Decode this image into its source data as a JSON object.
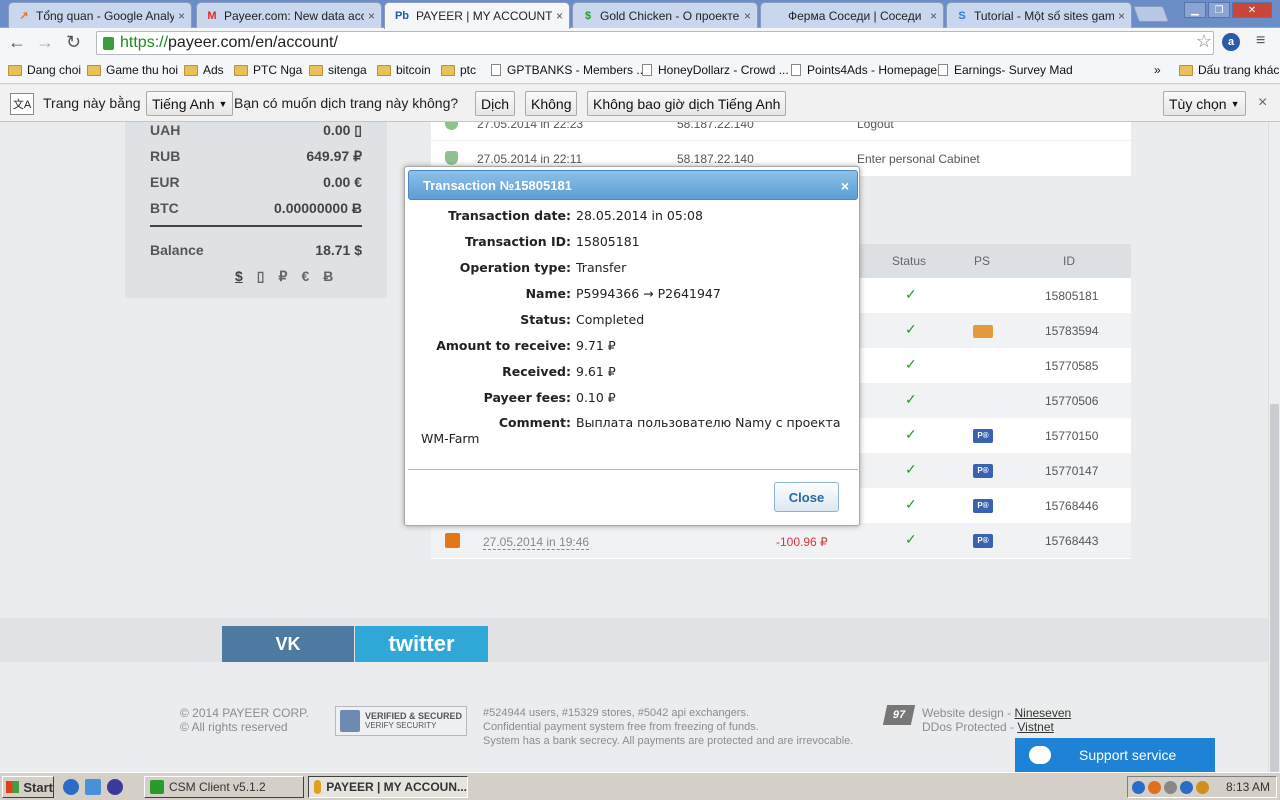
{
  "browser": {
    "tabs": [
      {
        "label": "Tổng quan - Google Analytic",
        "favicon": "analytics-icon",
        "color": "#e4761c"
      },
      {
        "label": "Payeer.com: New data acce",
        "favicon": "gmail-icon",
        "color": "#d93025"
      },
      {
        "label": "PAYEER | MY ACCOUNT",
        "favicon": "payeer-icon",
        "color": "#1e5aa8",
        "active": true
      },
      {
        "label": "Gold Chicken - О проекте",
        "favicon": "dollar-icon",
        "color": "#2a9a2a"
      },
      {
        "label": "Ферма Соседи | Соседи",
        "favicon": "blank-icon",
        "color": "#999999"
      },
      {
        "label": "Tutorial - Một số sites game",
        "favicon": "s-icon",
        "color": "#2b7bd8"
      }
    ],
    "fav_glyphs": {
      "analytics": "↗",
      "gmail": "M",
      "payeer": "Pb",
      "dollar": "$",
      "s": "S"
    },
    "nav": {
      "back": "←",
      "forward": "→",
      "reload": "↻"
    },
    "url_scheme": "https://",
    "url_rest": "payeer.com/en/account/",
    "star": "☆"
  },
  "bookmarks": {
    "items": [
      {
        "label": "Dang choi",
        "type": "folder"
      },
      {
        "label": "Game thu hoi",
        "type": "folder"
      },
      {
        "label": "Ads",
        "type": "folder"
      },
      {
        "label": "PTC Nga",
        "type": "folder"
      },
      {
        "label": "sitenga",
        "type": "folder"
      },
      {
        "label": "bitcoin",
        "type": "folder"
      },
      {
        "label": "ptc",
        "type": "folder"
      },
      {
        "label": "GPTBANKS - Members ...",
        "type": "page"
      },
      {
        "label": "HoneyDollarz - Crowd ...",
        "type": "page"
      },
      {
        "label": "Points4Ads - Homepage",
        "type": "page"
      },
      {
        "label": "Earnings- Survey Mad",
        "type": "page"
      }
    ],
    "overflow": "»",
    "other": "Dấu trang khác"
  },
  "translate_bar": {
    "prefix": "Trang này bằng",
    "language": "Tiếng Anh",
    "question": "Bạn có muốn dịch trang này không?",
    "translate_btn": "Dịch",
    "no_btn": "Không",
    "never_btn": "Không bao giờ dịch Tiếng Anh",
    "options_btn": "Tùy chọn",
    "close": "×"
  },
  "balances": [
    {
      "currency": "UAH",
      "value": "0.00 ",
      "symbol": "▯"
    },
    {
      "currency": "RUB",
      "value": "649.97 ",
      "symbol": "₽"
    },
    {
      "currency": "EUR",
      "value": "0.00 ",
      "symbol": "€"
    },
    {
      "currency": "BTC",
      "value": "0.00000000 ",
      "symbol": "Ƀ"
    }
  ],
  "balance_total": {
    "label": "Balance",
    "value": "18.71 $"
  },
  "currency_links": [
    "$",
    "▯",
    "₽",
    "€",
    "Ƀ"
  ],
  "login_log": [
    {
      "date": "27.05.2014 in 22:23",
      "ip": "58.187.22.140",
      "action": "Logout"
    },
    {
      "date": "27.05.2014 in 22:11",
      "ip": "58.187.22.140",
      "action": "Enter personal Cabinet"
    }
  ],
  "history": {
    "headers": {
      "status": "Status",
      "ps": "PS",
      "id": "ID"
    },
    "rows": [
      {
        "id": "15805181",
        "ps": ""
      },
      {
        "id": "15783594",
        "ps": "orange"
      },
      {
        "id": "15770585",
        "ps": ""
      },
      {
        "id": "15770506",
        "ps": ""
      },
      {
        "id": "15770150",
        "ps": "blue"
      },
      {
        "id": "15770147",
        "ps": "blue"
      },
      {
        "id": "15768446",
        "ps": "blue"
      },
      {
        "id": "15768443",
        "ps": "blue",
        "date": "27.05.2014 in 19:46",
        "amount": "-100.96 ₽"
      }
    ],
    "check": "✓",
    "ps_label": "P®"
  },
  "social": {
    "vk": "VK",
    "twitter": "twitter"
  },
  "footer": {
    "copyright1": "© 2014 PAYEER CORP.",
    "copyright2": "© All rights reserved",
    "verified1": "VERIFIED & SECURED",
    "verified2": "VERIFY SECURITY",
    "stats": "#524944 users, #15329 stores, #5042 api exchangers.",
    "line2": "Confidential payment system free from freezing of funds.",
    "line3": "System has a bank secrecy. All payments are protected and are irrevocable.",
    "badge": "97",
    "design_prefix": "Website design - ",
    "design_link": "Nineseven",
    "ddos_prefix": "DDos Protected - ",
    "ddos_link": "Vistnet",
    "support": "Support service"
  },
  "modal": {
    "title": "Transaction №15805181",
    "close_x": "×",
    "fields": [
      {
        "label": "Transaction date:",
        "value": "28.05.2014 in 05:08"
      },
      {
        "label": "Transaction ID:",
        "value": "15805181"
      },
      {
        "label": "Operation type:",
        "value": "Transfer"
      },
      {
        "label": "Name:",
        "value": "P5994366 → P2641947"
      },
      {
        "label": "Status:",
        "value": "Completed"
      },
      {
        "label": "Amount to receive:",
        "value": "9.71 ₽"
      },
      {
        "label": "Received:",
        "value": "9.61 ₽"
      },
      {
        "label": "Payeer fees:",
        "value": "0.10 ₽"
      }
    ],
    "comment_label": "Comment:",
    "comment_value": "Выплата пользователю Namy с проекта WM-Farm",
    "close_button": "Close"
  },
  "taskbar": {
    "start": "Start",
    "tasks": [
      {
        "label": "CSM Client v5.1.2",
        "active": false
      },
      {
        "label": "PAYEER | MY ACCOUN...",
        "active": true
      }
    ],
    "clock": "8:13 AM"
  }
}
